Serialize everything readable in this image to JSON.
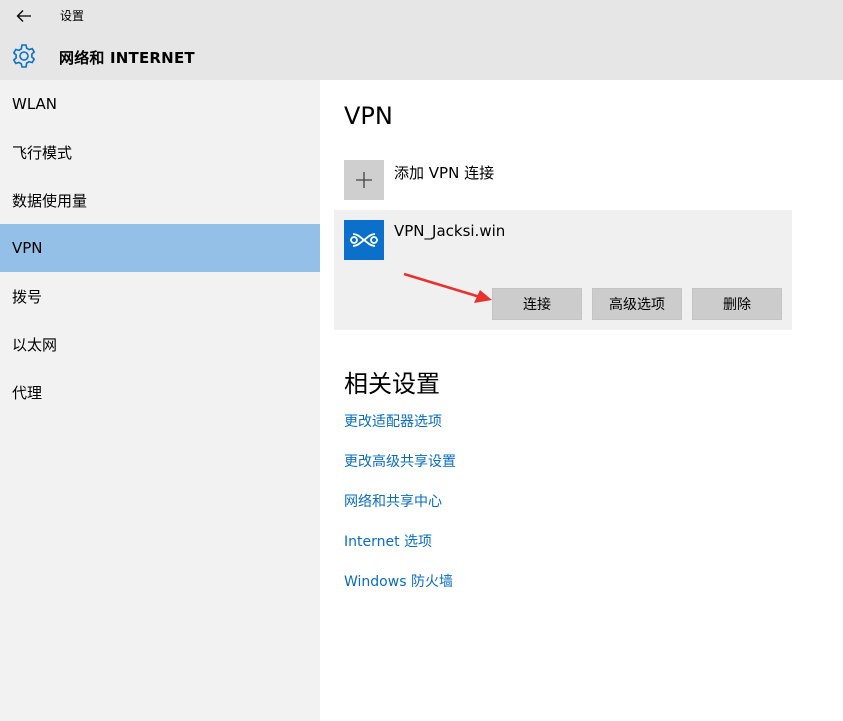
{
  "window": {
    "title": "设置"
  },
  "header": {
    "page_title": "网络和 INTERNET"
  },
  "sidebar": {
    "items": [
      {
        "label": "WLAN",
        "selected": false
      },
      {
        "label": "飞行模式",
        "selected": false
      },
      {
        "label": "数据使用量",
        "selected": false
      },
      {
        "label": "VPN",
        "selected": true
      },
      {
        "label": "拨号",
        "selected": false
      },
      {
        "label": "以太网",
        "selected": false
      },
      {
        "label": "代理",
        "selected": false
      }
    ]
  },
  "main": {
    "vpn_section_title": "VPN",
    "add_vpn_label": "添加 VPN 连接",
    "vpn_connection": {
      "name": "VPN_Jacksi.win",
      "buttons": {
        "connect": "连接",
        "advanced": "高级选项",
        "delete": "删除"
      }
    },
    "related_title": "相关设置",
    "related_links": [
      "更改适配器选项",
      "更改高级共享设置",
      "网络和共享中心",
      "Internet 选项",
      "Windows 防火墙"
    ]
  },
  "colors": {
    "accent": "#0a70c9",
    "selected_nav": "#94c0e7",
    "link": "#0a6cc4",
    "annotation_arrow": "#e8322e"
  },
  "icons": {
    "back": "back-arrow-icon",
    "settings": "gear-icon",
    "add": "plus-icon",
    "vpn": "vpn-icon",
    "annotation": "red-arrow-annotation"
  }
}
